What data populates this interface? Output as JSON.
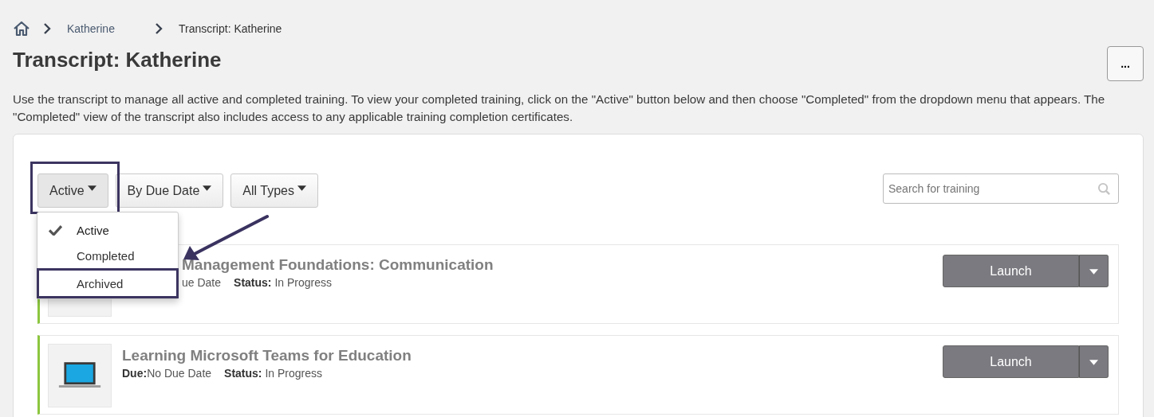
{
  "breadcrumb": {
    "items": [
      {
        "label": "Katherine",
        "current": false
      },
      {
        "label": "Transcript: Katherine",
        "current": true
      }
    ]
  },
  "title": "Transcript: Katherine",
  "more_button": {
    "label": "..."
  },
  "description": "Use the transcript to manage all active and completed training. To view your completed training, click on the \"Active\" button below and then choose \"Completed\" from the dropdown menu that appears. The \"Completed\" view of the transcript also includes access to any applicable training completion certificates.",
  "filters": [
    {
      "label": "Active",
      "expanded": true
    },
    {
      "label": "By Due Date",
      "expanded": false
    },
    {
      "label": "All Types",
      "expanded": false
    }
  ],
  "search": {
    "placeholder": "Search for training"
  },
  "status_menu": [
    {
      "label": "Active",
      "selected": true,
      "highlighted": false
    },
    {
      "label": "Completed",
      "selected": false,
      "highlighted": false
    },
    {
      "label": "Archived",
      "selected": false,
      "highlighted": true
    }
  ],
  "trainings": [
    {
      "title": "Management Foundations: Communication",
      "due": "ue Date",
      "status_label": "Status:",
      "status": "In Progress",
      "under_menu": true,
      "launch": "Launch"
    },
    {
      "title": "Learning Microsoft Teams for Education",
      "due_label": "Due:",
      "due": "No Due Date",
      "status_label": "Status:",
      "status": "In Progress",
      "under_menu": false,
      "launch": "Launch"
    }
  ]
}
